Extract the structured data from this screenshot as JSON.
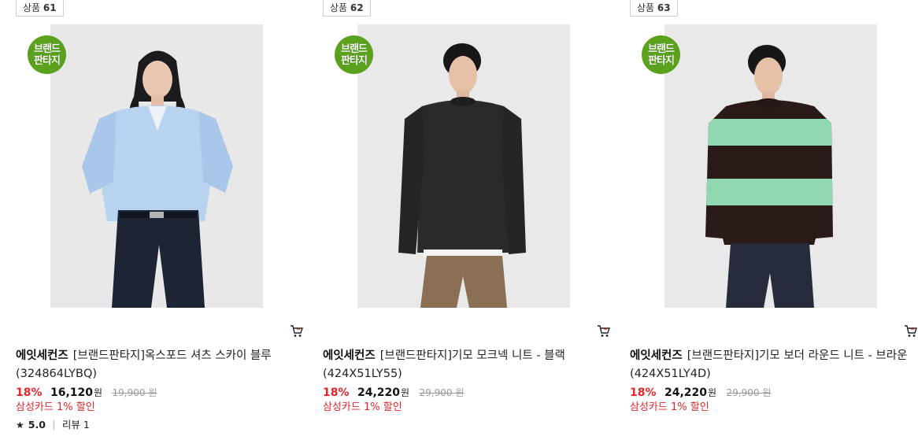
{
  "products": [
    {
      "label": "상품",
      "number": "61",
      "badge_line1": "브랜드",
      "badge_line2": "판타지",
      "brand": "에잇세컨즈",
      "name": "[브랜드판타지]옥스포드 셔츠 스카이 블루 (324864LYBQ)",
      "discount_rate": "18%",
      "price": "16,120",
      "price_unit": "원",
      "original_price": "19,900",
      "card_discount": "삼성카드 1% 할인",
      "rating": "5.0",
      "review_label": "리뷰 1",
      "icon": "cart-icon"
    },
    {
      "label": "상품",
      "number": "62",
      "badge_line1": "브랜드",
      "badge_line2": "판타지",
      "brand": "에잇세컨즈",
      "name": "[브랜드판타지]기모 모크넥 니트 - 블랙 (424X51LY55)",
      "discount_rate": "18%",
      "price": "24,220",
      "price_unit": "원",
      "original_price": "29,900",
      "card_discount": "삼성카드 1% 할인",
      "icon": "cart-icon"
    },
    {
      "label": "상품",
      "number": "63",
      "badge_line1": "브랜드",
      "badge_line2": "판타지",
      "brand": "에잇세컨즈",
      "name": "[브랜드판타지]기모 보더 라운드 니트 - 브라운 (424X51LY4D)",
      "discount_rate": "18%",
      "price": "24,220",
      "price_unit": "원",
      "original_price": "29,900",
      "card_discount": "삼성카드 1% 할인",
      "icon": "cart-icon"
    }
  ],
  "colors": {
    "badge_green": "#5aa21d",
    "discount_red": "#e3282c",
    "photo_bg": "#e9e9ea"
  }
}
